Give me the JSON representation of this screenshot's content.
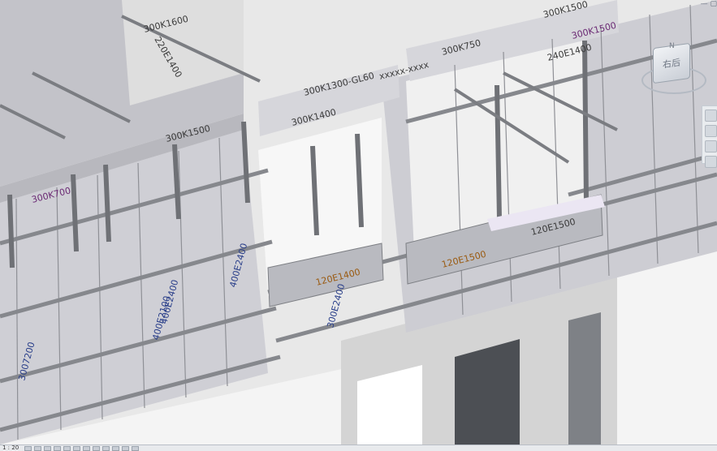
{
  "viewport": {
    "panel_labels": [
      {
        "text": "300K1500",
        "tone": "dark"
      },
      {
        "text": "300K1500",
        "tone": "purple"
      },
      {
        "text": "300K750",
        "tone": "dark"
      },
      {
        "text": "300K1300-GL60",
        "tone": "dark"
      },
      {
        "text": "300K1400",
        "tone": "dark"
      },
      {
        "text": "300K1600",
        "tone": "dark"
      },
      {
        "text": "300K700",
        "tone": "purple"
      },
      {
        "text": "300K1500",
        "tone": "dark"
      },
      {
        "text": "240E1400",
        "tone": "dark"
      },
      {
        "text": "220E1400",
        "tone": "dark"
      },
      {
        "text": "120E1500",
        "tone": "dark"
      },
      {
        "text": "120E1500",
        "tone": "orange"
      },
      {
        "text": "120E1400",
        "tone": "orange"
      },
      {
        "text": "400E2400",
        "tone": "blue"
      },
      {
        "text": "400E2400",
        "tone": "blue"
      },
      {
        "text": "400E2100",
        "tone": "blue"
      },
      {
        "text": "300E2400",
        "tone": "blue"
      },
      {
        "text": "3007200",
        "tone": "blue"
      }
    ],
    "small_mark": "xxxxx-xxxx"
  },
  "viewcube": {
    "face_label": "右后",
    "compass": "N"
  },
  "corner_control": "—  ▢",
  "status_bar": {
    "scale": "1 : 20",
    "control_count": 12
  },
  "colors": {
    "panel_face": "#c9c9cf",
    "panel_face_light": "#d8d8dd",
    "waler": "#8c8e92",
    "floor": "#e6e6e6",
    "slab_wall": "#d2d2d2",
    "shadow": "#777a7f"
  }
}
